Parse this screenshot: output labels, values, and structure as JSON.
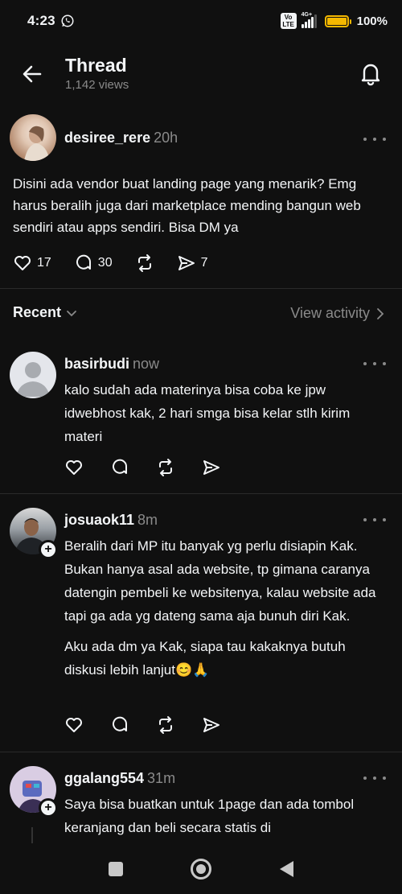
{
  "status": {
    "time": "4:23",
    "volte": "Vo LTE",
    "network": "4G+",
    "battery_pct": "100%",
    "battery_level": 1.0
  },
  "header": {
    "title": "Thread",
    "views": "1,142 views"
  },
  "post": {
    "username": "desiree_rere",
    "time": "20h",
    "text": "Disini ada vendor buat landing page yang menarik? Emg harus beralih juga dari marketplace mending bangun web sendiri atau apps sendiri. Bisa DM ya",
    "likes": "17",
    "replies": "30",
    "shares": "7"
  },
  "feed": {
    "sort_label": "Recent",
    "view_activity": "View activity"
  },
  "replies": [
    {
      "username": "basirbudi",
      "time": "now",
      "paragraphs": [
        "kalo sudah ada materinya bisa coba ke jpw idwebhost kak, 2 hari smga bisa kelar stlh kirim materi"
      ]
    },
    {
      "username": "josuaok11",
      "time": "8m",
      "paragraphs": [
        "Beralih dari MP itu banyak yg perlu disiapin Kak. Bukan hanya asal ada website, tp gimana caranya datengin pembeli ke websitenya, kalau website ada tapi ga ada yg dateng sama aja bunuh diri Kak.",
        "Aku ada dm ya Kak, siapa tau kakaknya butuh diskusi lebih lanjut😊🙏"
      ]
    },
    {
      "username": "ggalang554",
      "time": "31m",
      "paragraphs": [
        "Saya bisa buatkan untuk 1page dan ada tombol keranjang dan beli secara statis di"
      ]
    }
  ],
  "colors": {
    "background": "#101010",
    "text": "#f3f5f7",
    "muted": "#8a8a8a",
    "battery": "#f5b800"
  }
}
